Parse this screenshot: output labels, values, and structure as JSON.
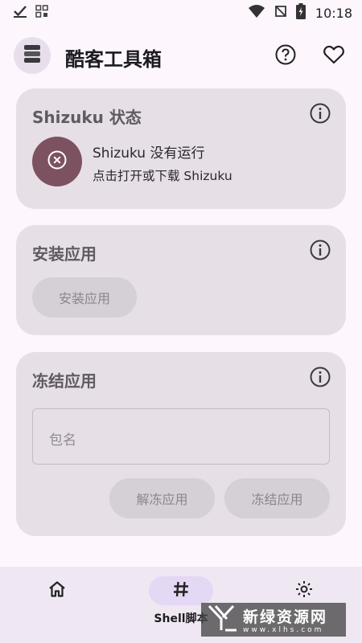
{
  "status_bar": {
    "time": "10:18",
    "left_icons": [
      "check-icon",
      "notification-grid-icon"
    ],
    "right_icons": [
      "wifi-icon",
      "no-sim-icon",
      "battery-icon"
    ]
  },
  "app_bar": {
    "title": "酷客工具箱",
    "logo_icon": "stacked-layers-icon",
    "actions": [
      "help-icon",
      "favorite-heart-icon"
    ]
  },
  "shizuku_card": {
    "title": "Shizuku 状态",
    "status": "Shizuku 没有运行",
    "hint": "点击打开或下载 Shizuku",
    "status_icon": "close-circle-icon",
    "status_color": "#7d5260"
  },
  "install_card": {
    "title": "安装应用",
    "button_label": "安装应用"
  },
  "freeze_card": {
    "title": "冻结应用",
    "field_placeholder": "包名",
    "unfreeze_label": "解冻应用",
    "freeze_label": "冻结应用"
  },
  "bottom_nav": {
    "items": [
      {
        "icon": "home-icon",
        "label": ""
      },
      {
        "icon": "hash-icon",
        "label": "Shell脚本"
      },
      {
        "icon": "settings-icon",
        "label": ""
      }
    ],
    "selected": 1
  },
  "watermark": {
    "main": "新绿资源网",
    "sub": "www.xlhs.com"
  },
  "colors": {
    "background": "#fdf7fd",
    "card": "#e6dfe6",
    "accent": "#7d5260",
    "nav_bar": "#efe8f2",
    "nav_indicator": "#e4d8f5"
  }
}
